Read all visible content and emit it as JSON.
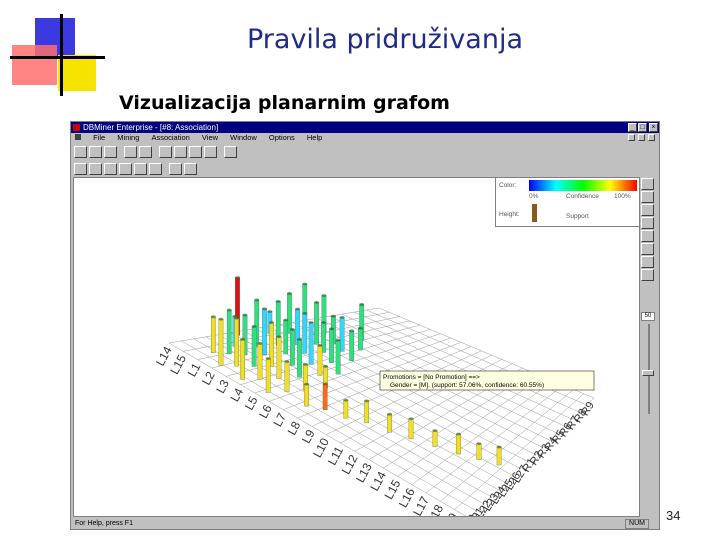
{
  "slide": {
    "title": "Pravila pridruživanja",
    "subtitle": "Vizualizacija planarnim grafom",
    "page_number": "34"
  },
  "window": {
    "title": "DBMiner Enterprise - [#8: Association]",
    "min": "_",
    "max": "□",
    "close": "×"
  },
  "menu": [
    "File",
    "Mining",
    "Association",
    "View",
    "Window",
    "Options",
    "Help"
  ],
  "legend": {
    "color_label": "Color:",
    "color_min": "0%",
    "color_caption": "Confidence",
    "color_max": "100%",
    "height_label": "Height:",
    "height_caption": "Support"
  },
  "tooltip": {
    "line1": "Promotions = [No Promotion] ==>",
    "line2": "Gender = [M]. (support: 57.06%, confidence: 60.55%)"
  },
  "slider": {
    "value": "50"
  },
  "status": {
    "left": "For Help, press F1",
    "right": "NUM"
  },
  "axis": {
    "left_labels": [
      "L14",
      "L15",
      "L1",
      "L2",
      "L3",
      "L4",
      "L5",
      "L6",
      "L7",
      "L8",
      "L9",
      "L10",
      "L11",
      "L12",
      "L13",
      "L14",
      "L15",
      "L16",
      "L17",
      "L18",
      "L19"
    ],
    "right_labels": [
      "L20",
      "L21",
      "L22",
      "L23",
      "L24",
      "L25",
      "L26",
      "L27",
      "R1",
      "R2",
      "R3",
      "R4",
      "R5",
      "R6",
      "R7",
      "R8",
      "R9"
    ]
  },
  "colors": {
    "yellow": "#f0e020",
    "green": "#30e080",
    "cyan": "#30d8ff",
    "orange": "#ff6a10",
    "red": "#e01010"
  }
}
